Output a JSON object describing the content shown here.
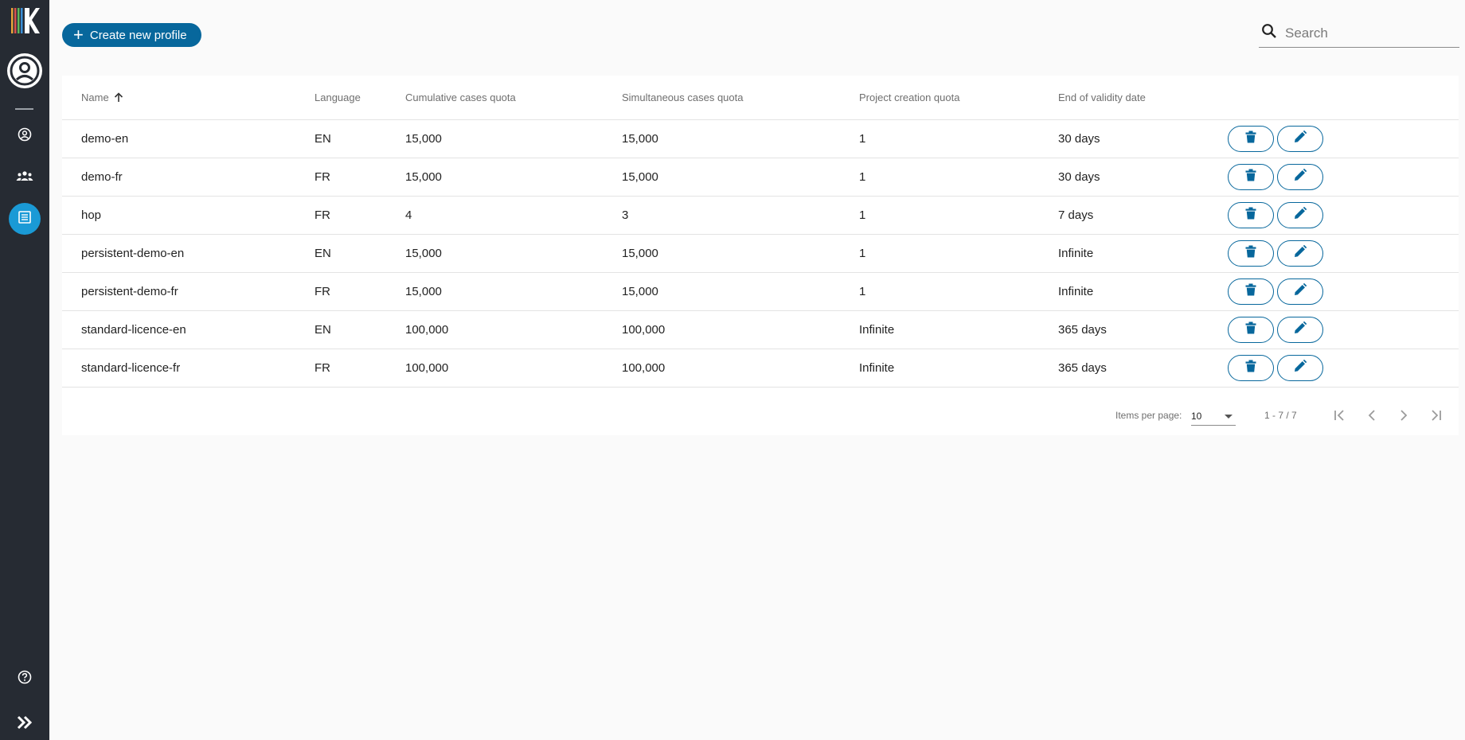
{
  "sidebar": {
    "logo_icon": "k-logo-icon",
    "avatar_icon": "user-circle-icon",
    "nav": [
      {
        "id": "profile",
        "icon": "account-circle-icon"
      },
      {
        "id": "groups",
        "icon": "groups-icon"
      },
      {
        "id": "licences",
        "icon": "list-icon",
        "active": true
      }
    ],
    "help_icon": "help-circle-icon",
    "expand_icon": "double-chevron-right-icon"
  },
  "toolbar": {
    "create_label": "Create new profile",
    "search_placeholder": "Search"
  },
  "table": {
    "columns": [
      "Name",
      "Language",
      "Cumulative cases quota",
      "Simultaneous cases quota",
      "Project creation quota",
      "End of validity date"
    ],
    "sort": {
      "column": "Name",
      "direction": "asc"
    },
    "rows": [
      {
        "name": "demo-en",
        "language": "EN",
        "cumulative": "15,000",
        "simultaneous": "15,000",
        "project": "1",
        "end": "30 days"
      },
      {
        "name": "demo-fr",
        "language": "FR",
        "cumulative": "15,000",
        "simultaneous": "15,000",
        "project": "1",
        "end": "30 days"
      },
      {
        "name": "hop",
        "language": "FR",
        "cumulative": "4",
        "simultaneous": "3",
        "project": "1",
        "end": "7 days"
      },
      {
        "name": "persistent-demo-en",
        "language": "EN",
        "cumulative": "15,000",
        "simultaneous": "15,000",
        "project": "1",
        "end": "Infinite"
      },
      {
        "name": "persistent-demo-fr",
        "language": "FR",
        "cumulative": "15,000",
        "simultaneous": "15,000",
        "project": "1",
        "end": "Infinite"
      },
      {
        "name": "standard-licence-en",
        "language": "EN",
        "cumulative": "100,000",
        "simultaneous": "100,000",
        "project": "Infinite",
        "end": "365 days"
      },
      {
        "name": "standard-licence-fr",
        "language": "FR",
        "cumulative": "100,000",
        "simultaneous": "100,000",
        "project": "Infinite",
        "end": "365 days"
      }
    ],
    "row_actions": [
      "delete-icon",
      "edit-icon"
    ]
  },
  "paginator": {
    "items_per_page_label": "Items per page:",
    "items_per_page": "10",
    "range": "1 - 7 / 7"
  },
  "colors": {
    "sidebar_bg": "#262b33",
    "accent": "#07679c",
    "active_nav": "#1a9ad6"
  }
}
